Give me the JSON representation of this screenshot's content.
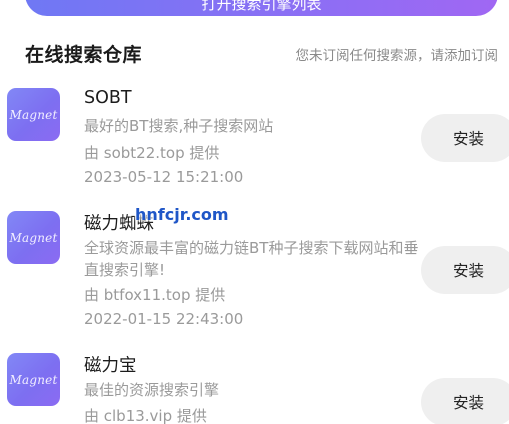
{
  "top_button": {
    "label": "打开搜索引擎列表"
  },
  "section": {
    "title": "在线搜索仓库",
    "note": "您未订阅任何搜索源，请添加订阅"
  },
  "items": [
    {
      "icon_text": "Magnet",
      "name": "SOBT",
      "description": "最好的BT搜索,种子搜索网站",
      "provider": "由 sobt22.top 提供",
      "date": "2023-05-12 15:21:00",
      "install_label": "安装"
    },
    {
      "icon_text": "Magnet",
      "name": "磁力蜘蛛",
      "description": "全球资源最丰富的磁力链BT种子搜索下载网站和垂直搜索引擎!",
      "provider": "由 btfox11.top 提供",
      "date": "2022-01-15 22:43:00",
      "install_label": "安装"
    },
    {
      "icon_text": "Magnet",
      "name": "磁力宝",
      "description": "最佳的资源搜索引擎",
      "provider": "由 clb13.vip 提供",
      "date": "",
      "install_label": "安装"
    }
  ],
  "watermark": "hnfcjr.com",
  "colors": {
    "accent_start": "#6f78f4",
    "accent_end": "#a067f3",
    "icon_bg": "#7d6ff1",
    "button_bg": "#efefef",
    "muted_text": "#9a9a9a",
    "watermark": "#1f56c7"
  }
}
